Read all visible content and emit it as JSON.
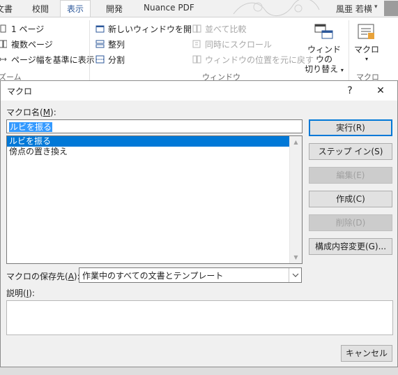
{
  "ribbon": {
    "tabs": [
      "文書",
      "校閲",
      "表示",
      "開発",
      "Nuance PDF"
    ],
    "active_tab": "表示",
    "user_name": "風亜 若横",
    "zoom_group": {
      "items": [
        "1 ページ",
        "複数ページ",
        "ページ幅を基準に表示"
      ],
      "label": "ズーム"
    },
    "window_group": {
      "items_left": [
        "新しいウィンドウを開く",
        "整列",
        "分割"
      ],
      "items_right": [
        "並べて比較",
        "同時にスクロール",
        "ウィンドウの位置を元に戻す"
      ],
      "switch_label_1": "ウィンドウの",
      "switch_label_2": "切り替え",
      "label": "ウィンドウ"
    },
    "macro_group": {
      "button_label": "マクロ",
      "label": "マクロ"
    }
  },
  "dialog": {
    "title": "マクロ",
    "help_glyph": "?",
    "close_glyph": "✕",
    "macro_name_label": "マクロ名(",
    "macro_name_key": "M",
    "macro_name_label_end": "):",
    "macro_name_value": "ルビを振る",
    "macros": [
      "ルビを振る",
      "傍点の置き換え"
    ],
    "buttons": {
      "run": "実行(R)",
      "step_in": "ステップ イン(S)",
      "edit": "編集(E)",
      "create": "作成(C)",
      "delete": "削除(D)",
      "organizer": "構成内容変更(G)...",
      "cancel": "キャンセル"
    },
    "store_label": "マクロの保存先(",
    "store_key": "A",
    "store_label_end": "):",
    "store_value": "作業中のすべての文書とテンプレート",
    "description_label": "説明(",
    "description_key": "I",
    "description_label_end": "):",
    "description_value": ""
  }
}
